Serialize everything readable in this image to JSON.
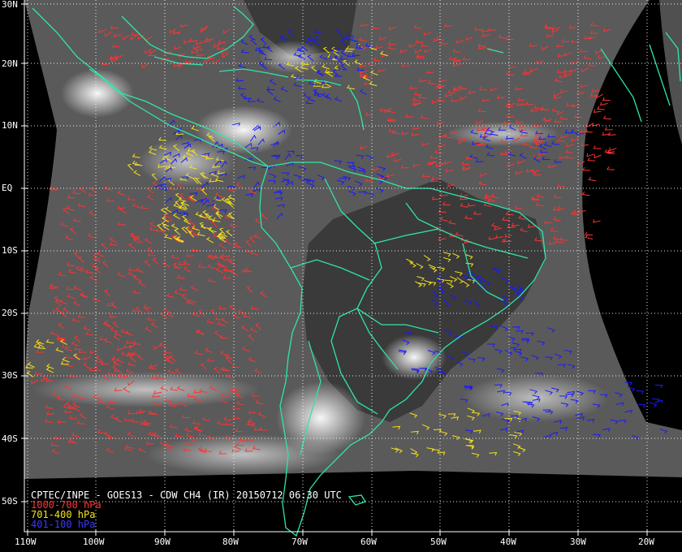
{
  "caption": {
    "title": "CPTEC/INPE - GOES13 - CDW CH4 (IR) 20150712 06:30 UTC",
    "legend": [
      {
        "label": "1000-700 hPa",
        "color": "#ff3333"
      },
      {
        "label": "701-400 hPa",
        "color": "#f4e21a"
      },
      {
        "label": "401-100 hPa",
        "color": "#1a1aff"
      }
    ]
  },
  "lat_labels": [
    "30N",
    "20N",
    "10N",
    "EQ",
    "10S",
    "20S",
    "30S",
    "40S",
    "50S"
  ],
  "lon_labels": [
    "110W",
    "100W",
    "90W",
    "80W",
    "70W",
    "60W",
    "50W",
    "40W",
    "30W",
    "20W"
  ],
  "colors": {
    "coast": "#2ee6a6",
    "grid": "#ffffff",
    "background": "#000000"
  }
}
